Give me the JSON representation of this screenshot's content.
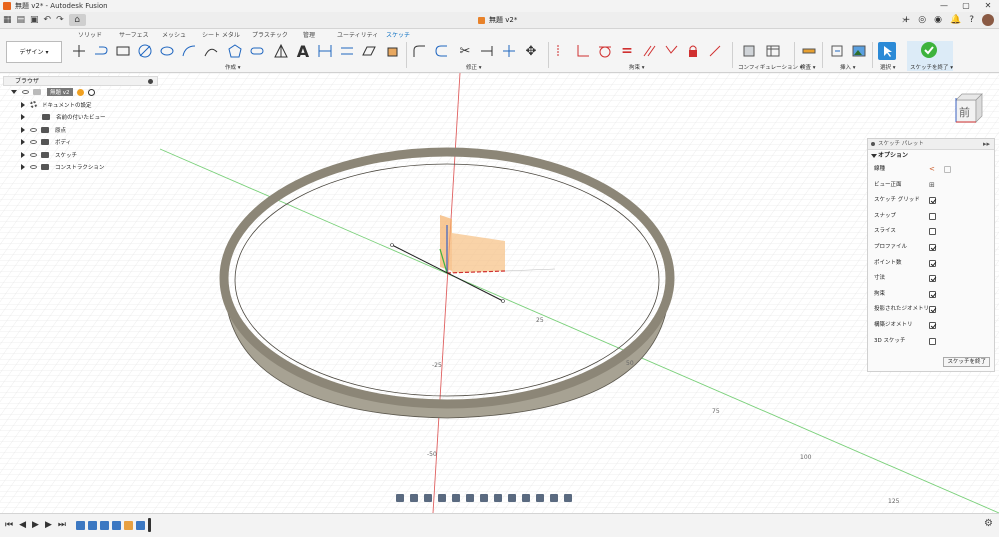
{
  "window": {
    "title": "無題 v2* - Autodesk Fusion",
    "controls": [
      "—",
      "▢",
      "✕"
    ]
  },
  "document_tab": {
    "title": "無題 v2*"
  },
  "toolbar_tabs": [
    "ソリッド",
    "サーフェス",
    "メッシュ",
    "シート メタル",
    "プラスチック",
    "管理",
    "ユーティリティ",
    "スケッチ"
  ],
  "active_tab": "スケッチ",
  "workspace": {
    "label": "デザイン ▾"
  },
  "ribbon_groups": {
    "create": "作成 ▾",
    "modify": "修正 ▾",
    "constraints": "拘束 ▾",
    "configure": "コンフィギュレーション ▾",
    "inspect": "検査 ▾",
    "insert": "挿入 ▾",
    "select": "選択 ▾",
    "finish": "スケッチを終了 ▾"
  },
  "browser": {
    "title": "ブラウザ",
    "root": "無題 v2",
    "items": [
      "ドキュメントの設定",
      "名前の付いたビュー",
      "原点",
      "ボディ",
      "スケッチ",
      "コンストラクション"
    ]
  },
  "viewcube": {
    "face": "前"
  },
  "axis_labels": [
    "25",
    "-25",
    "50",
    "-50",
    "75",
    "100",
    "125"
  ],
  "sketch_palette": {
    "title": "スケッチ パレット",
    "section": "オプション",
    "rows": [
      {
        "label": "線種",
        "control": "linetype",
        "checked": false
      },
      {
        "label": "ビュー正面",
        "control": "button",
        "checked": false
      },
      {
        "label": "スケッチ グリッド",
        "control": "checkbox",
        "checked": true
      },
      {
        "label": "スナップ",
        "control": "checkbox",
        "checked": false
      },
      {
        "label": "スライス",
        "control": "checkbox",
        "checked": false
      },
      {
        "label": "プロファイル",
        "control": "checkbox",
        "checked": true
      },
      {
        "label": "ポイント数",
        "control": "checkbox",
        "checked": true
      },
      {
        "label": "寸法",
        "control": "checkbox",
        "checked": true
      },
      {
        "label": "拘束",
        "control": "checkbox",
        "checked": true
      },
      {
        "label": "投影されたジオメトリ",
        "control": "checkbox",
        "checked": true
      },
      {
        "label": "構築ジオメトリ",
        "control": "checkbox",
        "checked": true
      },
      {
        "label": "3D スケッチ",
        "control": "checkbox",
        "checked": false
      }
    ],
    "finish_button": "スケッチを終了"
  },
  "colors": {
    "ring": "#8c8677",
    "x_axis": "#e04040",
    "y_axis": "#4caf50",
    "accent": "#0b6fc2"
  }
}
